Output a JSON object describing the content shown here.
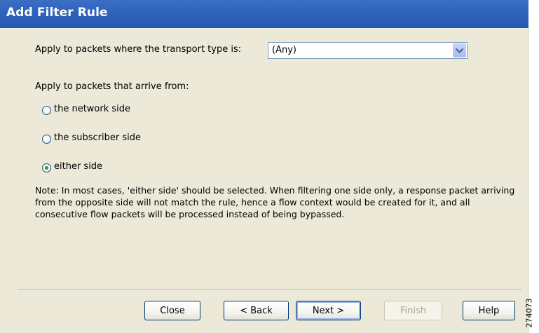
{
  "window": {
    "title": "Add Filter Rule"
  },
  "transport": {
    "label": "Apply to packets where the transport type is:",
    "selected": "(Any)",
    "dropdown_icon": "chevron-down-icon"
  },
  "arrive": {
    "label": "Apply to packets that arrive from:",
    "options": [
      {
        "label": "the network side",
        "selected": false
      },
      {
        "label": "the subscriber side",
        "selected": false
      },
      {
        "label": "either side",
        "selected": true
      }
    ]
  },
  "note": "Note: In most cases, 'either side' should be selected. When filtering one side only, a response packet arriving from the opposite side will not match the rule, hence a flow context would be created for it, and all consecutive flow packets will be processed instead of being bypassed.",
  "buttons": {
    "close": "Close",
    "back": "< Back",
    "next": "Next >",
    "finish": "Finish",
    "help": "Help"
  },
  "figure_id": "274073",
  "colors": {
    "titlebar": "#2f63bd",
    "dialog_bg": "#ece9d8",
    "radio_selected": "#21a121"
  }
}
